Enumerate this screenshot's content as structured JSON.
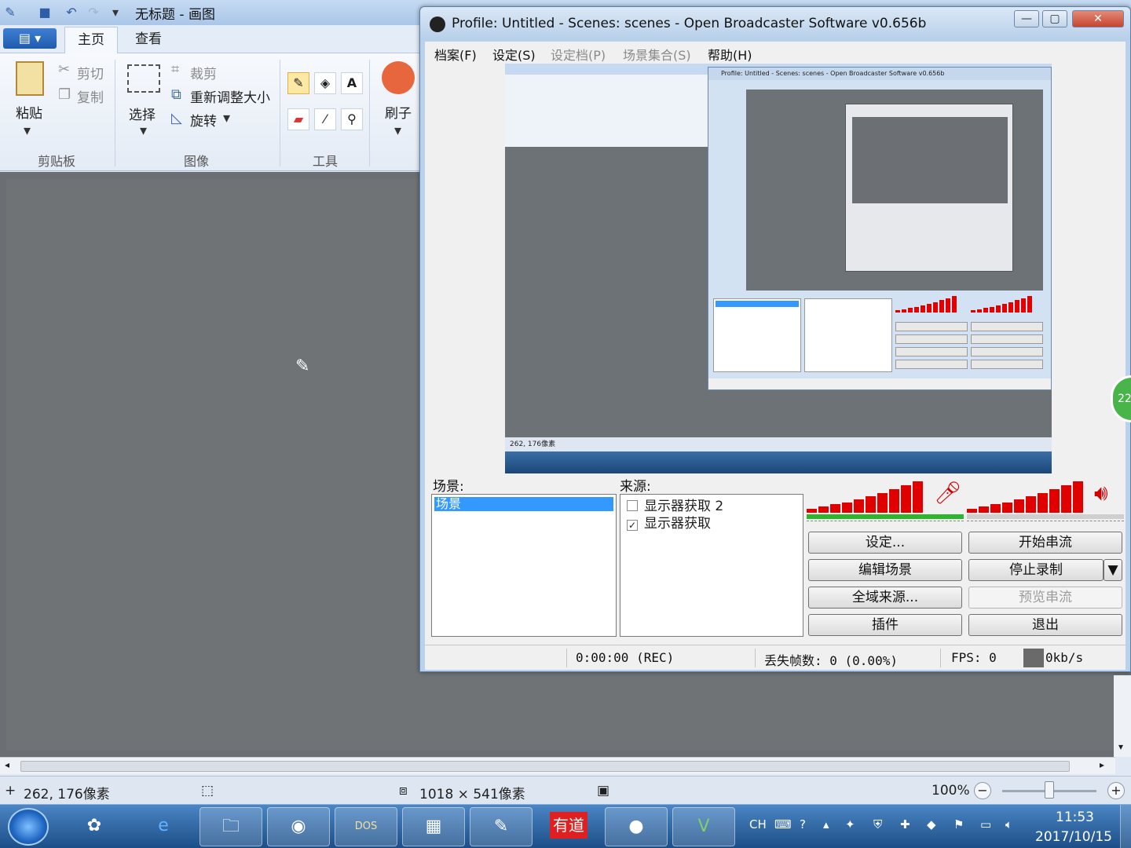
{
  "paint": {
    "title": "无标题 - 画图",
    "tabs": [
      "主页",
      "查看"
    ],
    "clipboard": {
      "paste": "粘贴",
      "cut": "剪切",
      "copy": "复制",
      "group": "剪贴板"
    },
    "image": {
      "select": "选择",
      "crop": "裁剪",
      "resize": "重新调整大小",
      "rotate": "旋转",
      "group": "图像"
    },
    "tools": {
      "group": "工具",
      "text_tool": "A"
    },
    "brushes": "刷子",
    "status": {
      "cursor_pos": "262, 176像素",
      "canvas_size": "1018 × 541像素",
      "zoom": "100%"
    }
  },
  "obs": {
    "title": "Profile: Untitled - Scenes: scenes - Open Broadcaster Software v0.656b",
    "menus": [
      {
        "label": "档案(F)",
        "enabled": true
      },
      {
        "label": "设定(S)",
        "enabled": true
      },
      {
        "label": "设定档(P)",
        "enabled": false
      },
      {
        "label": "场景集合(S)",
        "enabled": false
      },
      {
        "label": "帮助(H)",
        "enabled": true
      }
    ],
    "scenes_label": "场景:",
    "sources_label": "来源:",
    "scenes": [
      "场景"
    ],
    "sources": [
      {
        "label": "显示器获取 2",
        "checked": false
      },
      {
        "label": "显示器获取",
        "checked": true
      }
    ],
    "buttons": {
      "settings": "设定...",
      "start_stream": "开始串流",
      "edit_scene": "编辑场景",
      "stop_recording": "停止录制",
      "global_sources": "全域来源...",
      "preview_stream": "预览串流",
      "plugins": "插件",
      "exit": "退出"
    },
    "status": {
      "time": "0:00:00 (REC)",
      "dropped_frames": "丢失帧数: 0 (0.00%)",
      "fps": "FPS: 0",
      "bitrate": "0kb/s"
    },
    "mic_meter_levels": [
      0.12,
      0.18,
      0.25,
      0.32,
      0.4,
      0.5,
      0.6,
      0.72,
      0.84,
      0.95
    ],
    "desktop_meter_levels": [
      0.12,
      0.18,
      0.25,
      0.32,
      0.4,
      0.5,
      0.6,
      0.72,
      0.84,
      0.95
    ]
  },
  "taskbar": {
    "lang": "CH",
    "time": "11:53",
    "date": "2017/10/15",
    "youdao_label": "有道",
    "dosbox_label": "DOS"
  },
  "bubble": "22"
}
